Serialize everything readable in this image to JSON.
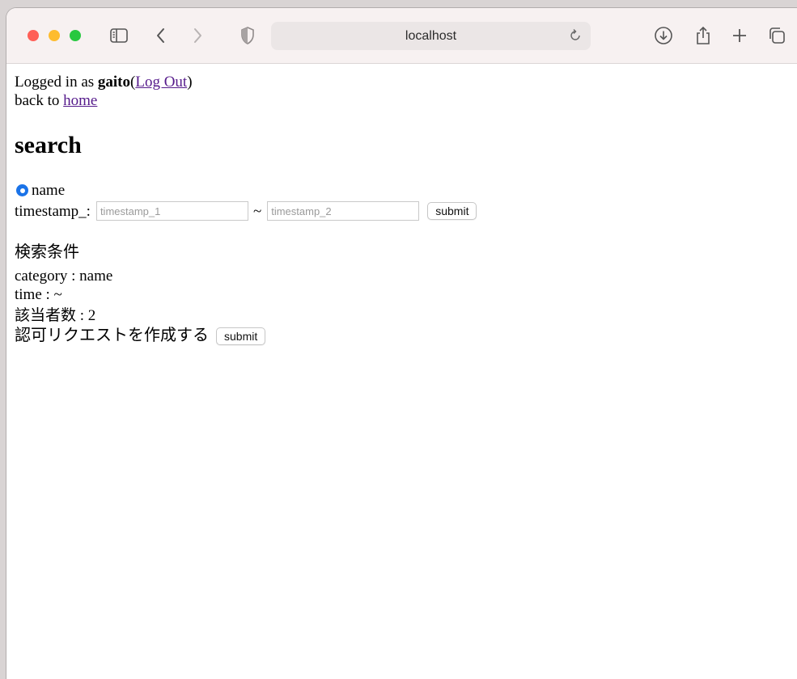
{
  "browser": {
    "url": "localhost"
  },
  "page": {
    "logged_in_prefix": "Logged in as ",
    "username": "gaito",
    "logout_open": "(",
    "logout_label": "Log Out",
    "logout_close": ")",
    "back_prefix": "back to ",
    "home_label": "home",
    "title": "search",
    "radio_name_label": "name",
    "timestamp_label": "timestamp_:",
    "timestamp_1_placeholder": "timestamp_1",
    "tilde": "~",
    "timestamp_2_placeholder": "timestamp_2",
    "submit_label": "submit"
  },
  "results": {
    "header": "検索条件",
    "category_line": "category : name",
    "time_line": "time : ~",
    "count_line": "該当者数 : 2",
    "request_label": "認可リクエストを作成する",
    "request_submit_label": "submit"
  }
}
